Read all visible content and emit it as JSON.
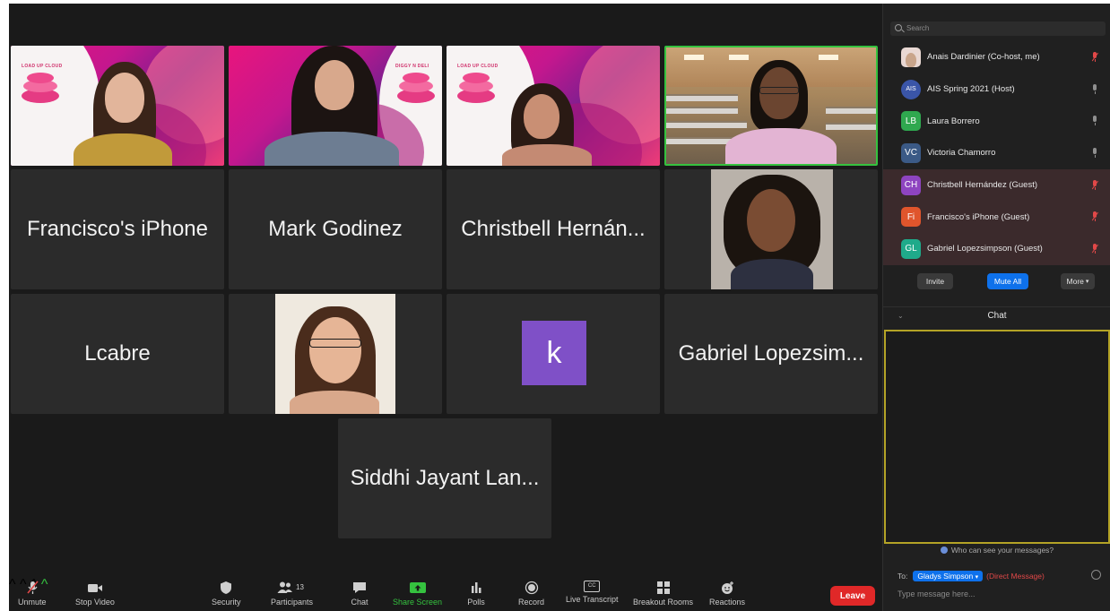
{
  "tiles": [
    {
      "name": "Francisco's iPhone",
      "row": 1,
      "col": 0
    },
    {
      "name": "Mark Godinez",
      "row": 1,
      "col": 1
    },
    {
      "name": "Christbell Hernán...",
      "row": 1,
      "col": 2
    },
    {
      "name": "Lcabre",
      "row": 2,
      "col": 0
    },
    {
      "name": "Gabriel Lopezsim...",
      "row": 2,
      "col": 3
    },
    {
      "name": "Siddhi Jayant Lan...",
      "row": 3,
      "col": 1.5
    }
  ],
  "avatar_k": "k",
  "toolbar": {
    "unmute": "Unmute",
    "stop_video": "Stop Video",
    "security": "Security",
    "participants": "Participants",
    "participants_count": "13",
    "chat": "Chat",
    "share_screen": "Share Screen",
    "polls": "Polls",
    "record": "Record",
    "live_transcript": "Live Transcript",
    "breakout_rooms": "Breakout Rooms",
    "reactions": "Reactions",
    "leave": "Leave",
    "cc_label": "CC"
  },
  "panel": {
    "search_placeholder": "Search",
    "participants": [
      {
        "initials": "",
        "name": "Anais Dardinier (Co-host, me)",
        "color": "#e9d8d3",
        "muted": true,
        "guest": false
      },
      {
        "initials": "AIS",
        "name": "AIS Spring 2021 (Host)",
        "color": "#3a55a8",
        "muted": false,
        "guest": false
      },
      {
        "initials": "LB",
        "name": "Laura Borrero",
        "color": "#2fa84f",
        "muted": false,
        "guest": false
      },
      {
        "initials": "VC",
        "name": "Victoria Chamorro",
        "color": "#3b5a86",
        "muted": false,
        "guest": false
      },
      {
        "initials": "CH",
        "name": "Christbell Hernández (Guest)",
        "color": "#8e44c0",
        "muted": true,
        "guest": true
      },
      {
        "initials": "Fi",
        "name": "Francisco's iPhone (Guest)",
        "color": "#e0552c",
        "muted": true,
        "guest": true
      },
      {
        "initials": "GL",
        "name": "Gabriel Lopezsimpson (Guest)",
        "color": "#1faa8a",
        "muted": true,
        "guest": true
      }
    ],
    "invite": "Invite",
    "mute_all": "Mute All",
    "more": "More",
    "chat_title": "Chat",
    "who_can_see": "Who can see your messages?",
    "to_label": "To:",
    "recipient": "Gladys Simpson",
    "direct_message": "(Direct Message)",
    "message_placeholder": "Type message here..."
  }
}
